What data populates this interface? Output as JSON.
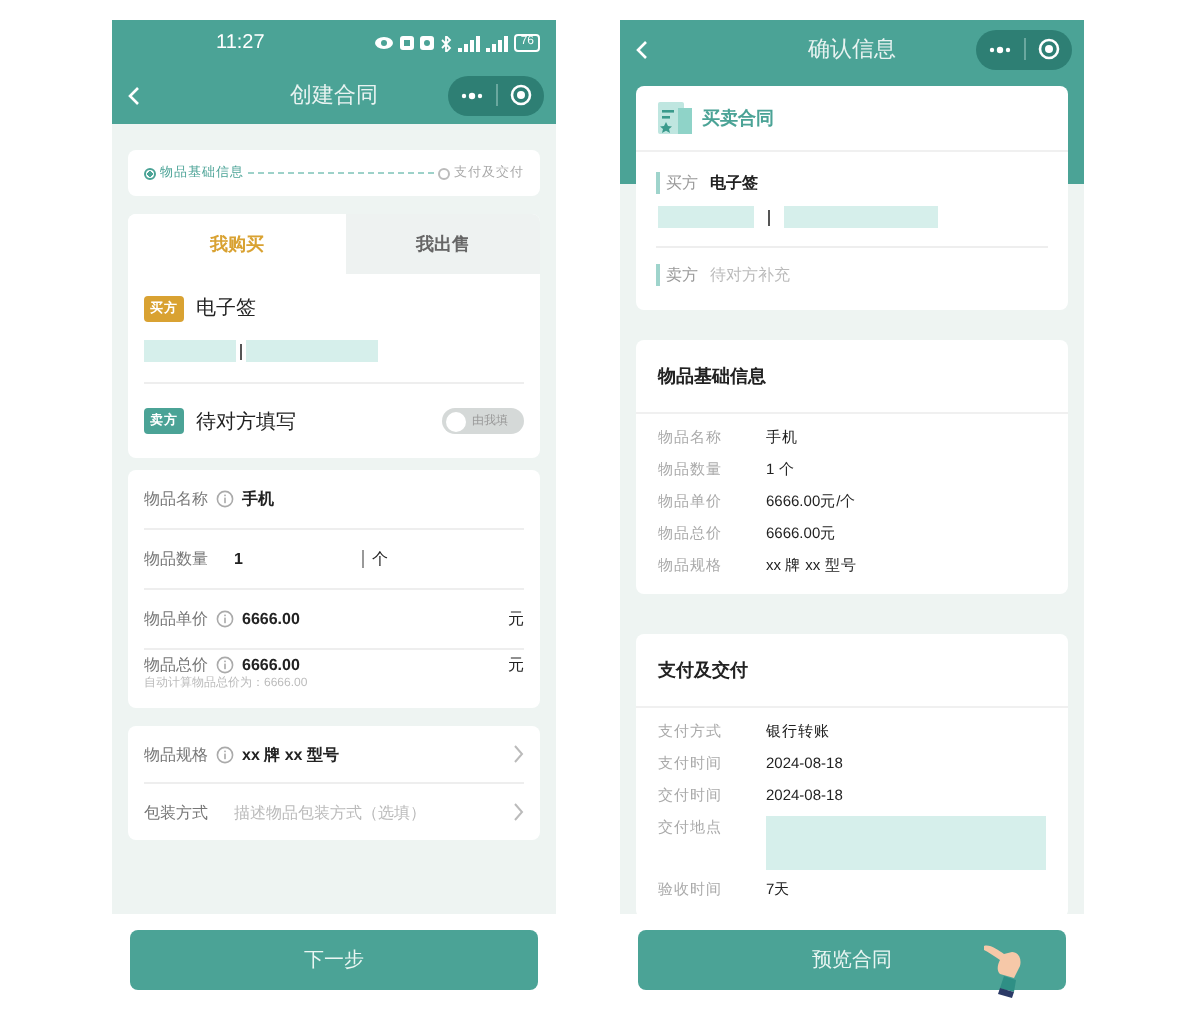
{
  "create_screen": {
    "status_bar": {
      "time": "11:27",
      "battery": "76"
    },
    "nav": {
      "title": "创建合同"
    },
    "steps": [
      {
        "label": "物品基础信息",
        "selected": true
      },
      {
        "label": "支付及交付",
        "selected": false
      }
    ],
    "tabs": [
      {
        "label": "我购买",
        "selected": true
      },
      {
        "label": "我出售",
        "selected": false
      }
    ],
    "buyer": {
      "tag": "买方",
      "name": "电子签",
      "contact_redacted": true
    },
    "seller": {
      "tag": "卖方",
      "name": "待对方填写",
      "toggle": {
        "label": "由我填",
        "on": false
      }
    },
    "fields": [
      {
        "label": "物品名称",
        "info": true,
        "value": "手机"
      },
      {
        "label": "物品数量",
        "info": false,
        "value": "1",
        "unit": "个",
        "kind": "split"
      },
      {
        "label": "物品单价",
        "info": true,
        "value": "6666.00",
        "unit": "元"
      },
      {
        "label": "物品总价",
        "info": true,
        "value": "6666.00",
        "unit": "元",
        "hint": "自动计算物品总价为：6666.00"
      }
    ],
    "options": [
      {
        "label": "物品规格",
        "info": true,
        "value": "xx 牌 xx 型号"
      },
      {
        "label": "包装方式",
        "info": false,
        "placeholder": "描述物品包装方式（选填）"
      }
    ],
    "button": "下一步"
  },
  "confirm_screen": {
    "nav": {
      "title": "确认信息"
    },
    "contract": {
      "title": "买卖合同",
      "buyer": {
        "label": "买方",
        "name": "电子签",
        "contact_redacted": true
      },
      "seller": {
        "label": "卖方",
        "name": "待对方补充"
      }
    },
    "sections": [
      {
        "title": "物品基础信息",
        "rows": [
          {
            "label": "物品名称",
            "value": "手机"
          },
          {
            "label": "物品数量",
            "value": "1 个"
          },
          {
            "label": "物品单价",
            "value": "6666.00元/个"
          },
          {
            "label": "物品总价",
            "value": "6666.00元"
          },
          {
            "label": "物品规格",
            "value": "xx 牌 xx 型号"
          }
        ]
      },
      {
        "title": "支付及交付",
        "rows": [
          {
            "label": "支付方式",
            "value": "银行转账"
          },
          {
            "label": "支付时间",
            "value": "2024-08-18"
          },
          {
            "label": "交付时间",
            "value": "2024-08-18"
          },
          {
            "label": "交付地点",
            "redacted": true
          },
          {
            "label": "验收时间",
            "value": "7天"
          }
        ]
      }
    ],
    "button": "预览合同"
  }
}
